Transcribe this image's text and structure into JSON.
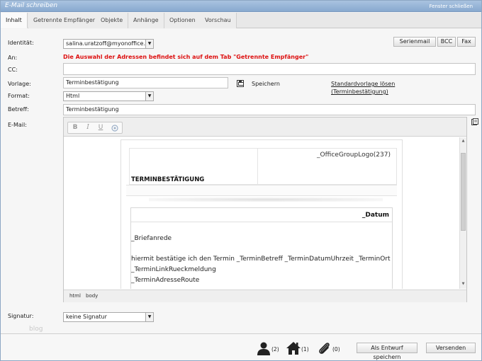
{
  "window": {
    "title": "E-Mail schreiben",
    "close_label": "Fenster schließen"
  },
  "tabs": [
    {
      "label": "Inhalt",
      "active": true
    },
    {
      "label": "Getrennte Empfänger",
      "active": false
    },
    {
      "label": "Objekte",
      "active": false
    },
    {
      "label": "Anhänge",
      "active": false
    },
    {
      "label": "Optionen",
      "active": false
    },
    {
      "label": "Vorschau",
      "active": false
    }
  ],
  "form": {
    "identitaet_label": "Identität:",
    "identitaet_value": "salina.uratzoff@myonoffice.de",
    "an_label": "An:",
    "an_warning": "Die Auswahl der Adressen befindet sich auf dem Tab \"Getrennte Empfänger\"",
    "cc_label": "CC:",
    "cc_value": "",
    "vorlage_label": "Vorlage:",
    "vorlage_value": "Terminbestätigung",
    "speichern_label": "Speichern",
    "standardvorlage_line1": "Standardvorlage lösen",
    "standardvorlage_line2": "(Terminbestätigung)",
    "format_label": "Format:",
    "format_value": "Html",
    "betreff_label": "Betreff:",
    "betreff_value": "Terminbestätigung",
    "email_label": "E-Mail:",
    "signatur_label": "Signatur:",
    "signatur_value": "keine Signatur"
  },
  "top_buttons": {
    "serienmail": "Serienmail",
    "bcc": "BCC",
    "fax": "Fax"
  },
  "editor": {
    "tools": {
      "bold": "B",
      "italic": "I",
      "underline": "U"
    },
    "logo_placeholder": "_OfficeGroupLogo(237)",
    "heading": "TERMINBESTÄTIGUNG",
    "datum": "_Datum",
    "lines": [
      "_Briefanrede",
      "hiermit bestätige ich den Termin _TerminBetreff _TerminDatumUhrzeit _TerminOrt",
      "_TerminLinkRueckmeldung",
      "_TerminAdresseRoute"
    ],
    "status_path": [
      "html",
      "body"
    ]
  },
  "watermark": "blog",
  "footer": {
    "contacts_count": "(2)",
    "estates_count": "(1)",
    "attachments_count": "(0)",
    "draft_button": "Als Entwurf speichern",
    "send_button": "Versenden"
  },
  "colors": {
    "titlebar": "#88a9cf",
    "warning": "#dd1111"
  }
}
